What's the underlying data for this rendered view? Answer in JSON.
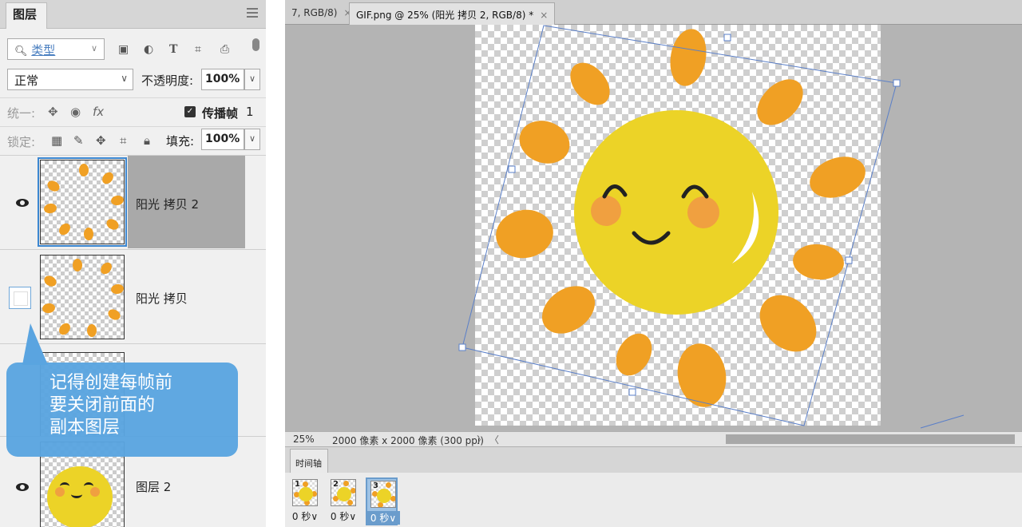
{
  "layers_panel": {
    "tab_label": "图层",
    "kind_filter": {
      "value": "类型"
    },
    "blend_mode": {
      "value": "正常"
    },
    "opacity": {
      "label": "不透明度:",
      "value": "100%"
    },
    "unify": {
      "label": "统一:"
    },
    "propagate": {
      "label": "传播帧",
      "value": "1",
      "checked": true
    },
    "lock": {
      "label": "锁定:"
    },
    "fill": {
      "label": "填充:",
      "value": "100%"
    },
    "layers": [
      {
        "name": "阳光 拷贝 2",
        "visible": true,
        "selected": true
      },
      {
        "name": "阳光 拷贝",
        "visible": false,
        "selected": false
      },
      {
        "name": "",
        "visible": false,
        "selected": false
      },
      {
        "name": "图层 2",
        "visible": true,
        "selected": false
      }
    ]
  },
  "callout": {
    "line1": "记得创建每帧前",
    "line2": "要关闭前面的",
    "line3": "副本图层",
    "color": "#5aa4e0"
  },
  "document": {
    "tabs": [
      {
        "label": "7, RGB/8)",
        "close": "×",
        "active": false
      },
      {
        "label": "GIF.png @ 25% (阳光 拷贝 2, RGB/8) *",
        "close": "×",
        "active": true
      }
    ],
    "status": {
      "zoom": "25%",
      "size_info": "2000 像素 x 2000 像素 (300 ppi)",
      "more": "〉",
      "prev": "〈"
    }
  },
  "timeline": {
    "tab_label": "时间轴",
    "frames": [
      {
        "number": "1",
        "delay": "0 秒",
        "chevron": "∨",
        "selected": false
      },
      {
        "number": "2",
        "delay": "0 秒",
        "chevron": "∨",
        "selected": false
      },
      {
        "number": "3",
        "delay": "0 秒",
        "chevron": "∨",
        "selected": true
      }
    ]
  },
  "colors": {
    "sun_face": "#ecd327",
    "sun_ray": "#f0a024",
    "cheek": "#f0a040",
    "selection_blue": "#3b86d0"
  }
}
